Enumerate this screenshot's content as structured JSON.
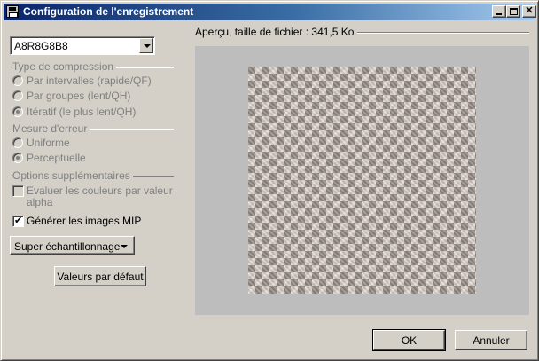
{
  "window": {
    "title": "Configuration de l'enregistrement"
  },
  "format_select": {
    "value": "A8R8G8B8"
  },
  "compression": {
    "label": "Type de compression",
    "options": [
      {
        "label": "Par intervalles (rapide/QF)",
        "checked": false
      },
      {
        "label": "Par groupes (lent/QH)",
        "checked": false
      },
      {
        "label": "Itératif (le plus lent/QH)",
        "checked": true
      }
    ]
  },
  "error_measure": {
    "label": "Mesure d'erreur",
    "options": [
      {
        "label": "Uniforme",
        "checked": false
      },
      {
        "label": "Perceptuelle",
        "checked": true
      }
    ]
  },
  "extra_options": {
    "label": "Options supplémentaires",
    "alpha_weighting": {
      "label_line1": "Evaluer les couleurs par valeur",
      "label_line2": "alpha",
      "checked": false
    },
    "mipmaps": {
      "label": "Générer les images MIP",
      "checked": true
    }
  },
  "sampling_select": {
    "value": "Super échantillonnage"
  },
  "defaults_button": {
    "label": "Valeurs par défaut"
  },
  "preview": {
    "label": "Aperçu, taille de fichier : 341,5 Ko"
  },
  "ok_button": {
    "label": "OK"
  },
  "cancel_button": {
    "label": "Annuler"
  },
  "icons": {
    "window_icon": "save-disk-icon",
    "minimize": "minimize-icon",
    "maximize": "maximize-icon",
    "close": "close-icon"
  }
}
